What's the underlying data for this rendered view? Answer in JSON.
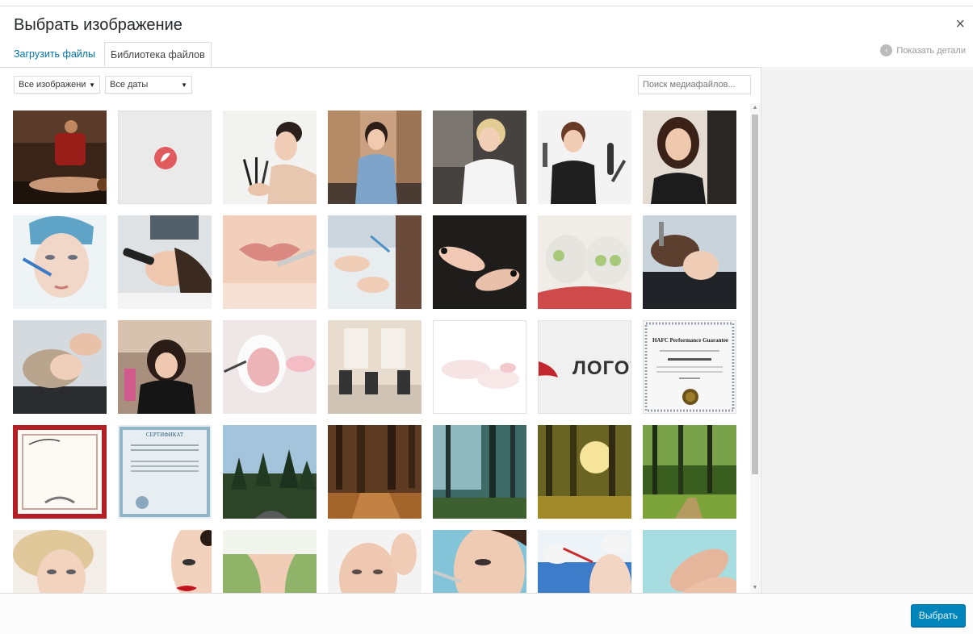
{
  "modal": {
    "title": "Выбрать изображение",
    "close_icon": "×"
  },
  "tabs": [
    {
      "label": "Загрузить файлы",
      "active": false
    },
    {
      "label": "Библиотека файлов",
      "active": true
    }
  ],
  "details_toggle": {
    "label": "Показать детали",
    "icon": "chevron-left-icon"
  },
  "filters": {
    "type_selected": "Все изображени",
    "date_selected": "Все даты",
    "search_placeholder": "Поиск медиафайлов..."
  },
  "thumbnails": [
    "massage",
    "logo-icon",
    "makeup-brushes",
    "salon-assistant",
    "blonde-stylist",
    "hairdresser-tools",
    "woman-portrait",
    "face-injection",
    "face-device",
    "lip-treatment",
    "manicure-white",
    "manicure-black",
    "cucumber-masks",
    "hair-wash",
    "hair-wash-2",
    "hair-styling",
    "face-mask-pink",
    "salon-interior",
    "manicure-faded",
    "logo-text",
    "certificate-hafc",
    "diploma-red",
    "certificate-blue",
    "forest-road",
    "forest-path",
    "forest-mist",
    "forest-sunlight",
    "forest-green",
    "blonde-face",
    "red-lips",
    "slim-waist",
    "face-touch",
    "eye-injection",
    "face-procedure",
    "hand-massage"
  ],
  "logo_text": "ЛОГОТ",
  "certificate_title": "HAFC Performance Guarantee",
  "certificate_blue_title": "СЕРТИФИКАТ",
  "footer": {
    "select_label": "Выбрать"
  },
  "colors": {
    "accent": "#0085ba",
    "link": "#0073aa",
    "sidebar": "#f3f3f3"
  }
}
